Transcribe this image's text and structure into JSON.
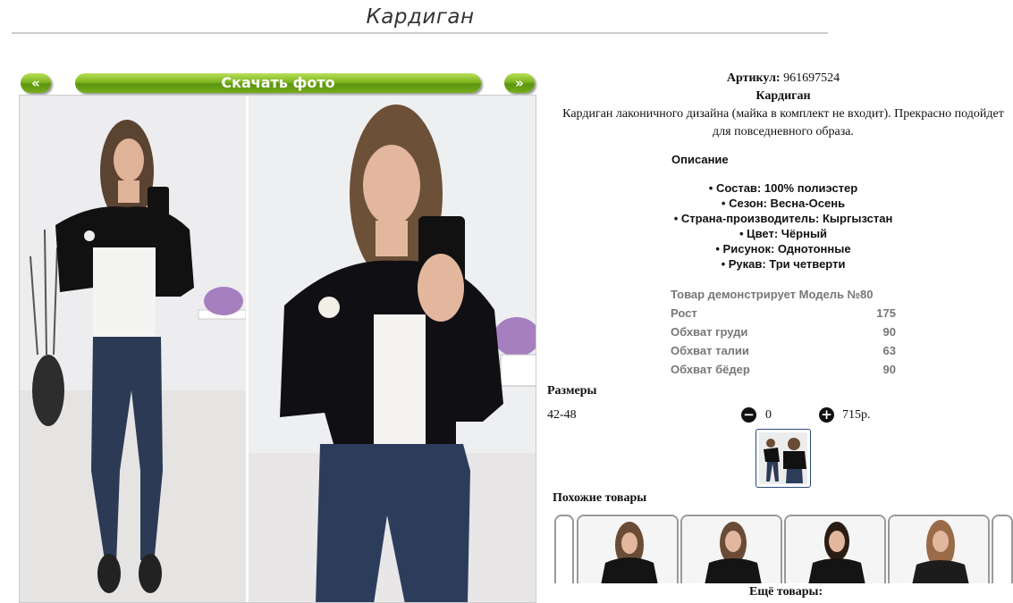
{
  "page": {
    "title": "Кардиган"
  },
  "gallery": {
    "prev_label": "«",
    "download_label": "Скачать фото",
    "next_label": "»"
  },
  "product": {
    "sku_label": "Артикул:",
    "sku_value": "961697524",
    "name": "Кардиган",
    "description": "Кардиган лаконичного дизайна (майка в комплект не входит). Прекрасно подойдет для повседневного образа.",
    "details_heading": "Описание",
    "features": [
      "• Состав: 100% полиэстер",
      "• Сезон: Весна-Осень",
      "• Страна-производитель: Кыргызстан",
      "• Цвет: Чёрный",
      "• Рисунок: Однотонные",
      "• Рукав: Три четверти"
    ],
    "model": {
      "heading": "Товар демонстрирует Модель №80",
      "rows": [
        {
          "label": "Рост",
          "value": "175"
        },
        {
          "label": "Обхват груди",
          "value": "90"
        },
        {
          "label": "Обхват талии",
          "value": "63"
        },
        {
          "label": "Обхват бёдер",
          "value": "90"
        }
      ]
    }
  },
  "sizes": {
    "heading": "Размеры",
    "size": "42-48",
    "minus_icon": "minus-circle-icon",
    "quantity": "0",
    "plus_icon": "plus-circle-icon",
    "price": "715р."
  },
  "similar": {
    "heading": "Похожие товары",
    "more_label": "Ещё товары:"
  },
  "colors": {
    "button_green": "#76ad1a",
    "border_gray": "#999999",
    "muted_text": "#777777"
  }
}
